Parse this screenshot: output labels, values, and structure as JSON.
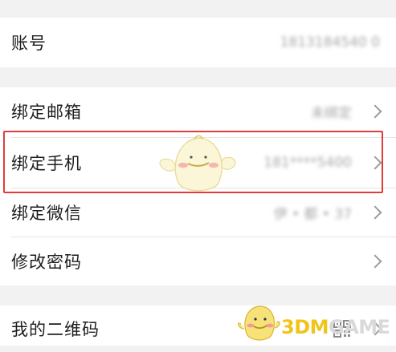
{
  "account": {
    "label": "账号",
    "value": "1813184540 0"
  },
  "bindings": {
    "email": {
      "label": "绑定邮箱",
      "value": "未绑定"
    },
    "phone": {
      "label": "绑定手机",
      "value": "181****5400"
    },
    "wechat": {
      "label": "绑定微信",
      "value": "伊 • 都 • 37"
    },
    "password": {
      "label": "修改密码"
    }
  },
  "qrcode": {
    "label": "我的二维码",
    "icon": "qr-code-icon"
  },
  "watermark": {
    "part_a": "3DM",
    "part_b": "GAME"
  },
  "colors": {
    "highlight": "#e23b3b",
    "background": "#f2f2f2",
    "text": "#1d1d1d"
  }
}
